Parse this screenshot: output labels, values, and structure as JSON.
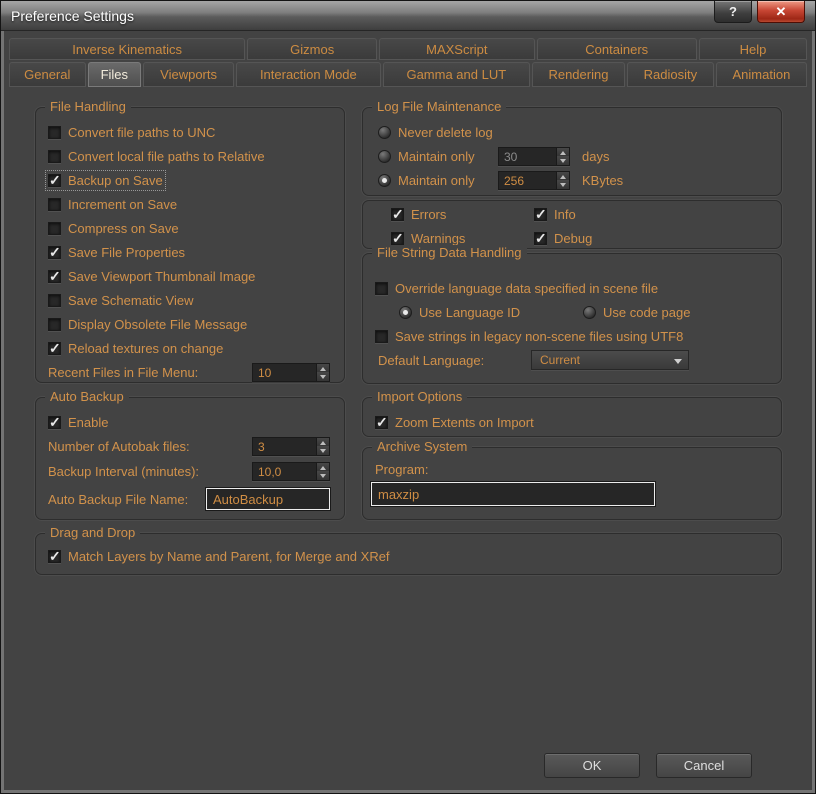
{
  "window": {
    "title": "Preference Settings",
    "help_glyph": "?",
    "close_glyph": "✕"
  },
  "tabs_row1": [
    {
      "label": "Inverse Kinematics",
      "active": false
    },
    {
      "label": "Gizmos",
      "active": false
    },
    {
      "label": "MAXScript",
      "active": false
    },
    {
      "label": "Containers",
      "active": false
    },
    {
      "label": "Help",
      "active": false
    }
  ],
  "tabs_row2": [
    {
      "label": "General",
      "active": false
    },
    {
      "label": "Files",
      "active": true
    },
    {
      "label": "Viewports",
      "active": false
    },
    {
      "label": "Interaction Mode",
      "active": false
    },
    {
      "label": "Gamma and LUT",
      "active": false
    },
    {
      "label": "Rendering",
      "active": false
    },
    {
      "label": "Radiosity",
      "active": false
    },
    {
      "label": "Animation",
      "active": false
    }
  ],
  "file_handling": {
    "title": "File Handling",
    "checkboxes": [
      {
        "label": "Convert file paths to UNC",
        "checked": false
      },
      {
        "label": "Convert local file paths to Relative",
        "checked": false
      },
      {
        "label": "Backup on Save",
        "checked": true,
        "focused": true
      },
      {
        "label": "Increment on Save",
        "checked": false
      },
      {
        "label": "Compress on Save",
        "checked": false
      },
      {
        "label": "Save File Properties",
        "checked": true
      },
      {
        "label": "Save Viewport Thumbnail Image",
        "checked": true
      },
      {
        "label": "Save Schematic View",
        "checked": false
      },
      {
        "label": "Display Obsolete File Message",
        "checked": false
      },
      {
        "label": "Reload textures on change",
        "checked": true
      }
    ],
    "recent_files": {
      "label": "Recent Files in File Menu:",
      "value": "10"
    }
  },
  "log_file_maintenance": {
    "title": "Log File Maintenance",
    "radios": [
      {
        "label": "Never delete log",
        "selected": false
      },
      {
        "label": "Maintain only",
        "selected": false,
        "value": "30",
        "unit": "days",
        "value_dimmed": true
      },
      {
        "label": "Maintain only",
        "selected": true,
        "value": "256",
        "unit": "KBytes",
        "value_dimmed": false
      }
    ],
    "checkboxes": [
      {
        "label": "Errors",
        "checked": true
      },
      {
        "label": "Info",
        "checked": true
      },
      {
        "label": "Warnings",
        "checked": true
      },
      {
        "label": "Debug",
        "checked": true
      }
    ]
  },
  "file_string": {
    "title": "File String Data Handling",
    "override": {
      "label": "Override language data specified in scene file",
      "checked": false
    },
    "use_language_id": {
      "label": "Use Language ID",
      "selected": true
    },
    "use_code_page": {
      "label": "Use code page",
      "selected": false
    },
    "utf8": {
      "label": "Save strings in legacy non-scene files using UTF8",
      "checked": false
    },
    "default_language": {
      "label": "Default Language:",
      "value": "Current"
    }
  },
  "auto_backup": {
    "title": "Auto Backup",
    "enable": {
      "label": "Enable",
      "checked": true
    },
    "num_files": {
      "label": "Number of Autobak files:",
      "value": "3"
    },
    "interval": {
      "label": "Backup Interval (minutes):",
      "value": "10,0"
    },
    "file_name": {
      "label": "Auto Backup File Name:",
      "value": "AutoBackup"
    }
  },
  "import_options": {
    "title": "Import Options",
    "zoom_extents": {
      "label": "Zoom Extents on Import",
      "checked": true
    }
  },
  "archive_system": {
    "title": "Archive System",
    "program_label": "Program:",
    "program_value": "maxzip"
  },
  "drag_and_drop": {
    "title": "Drag and Drop",
    "match_layers": {
      "label": "Match Layers by Name and Parent, for Merge and XRef",
      "checked": true
    }
  },
  "footer": {
    "ok": "OK",
    "cancel": "Cancel"
  }
}
